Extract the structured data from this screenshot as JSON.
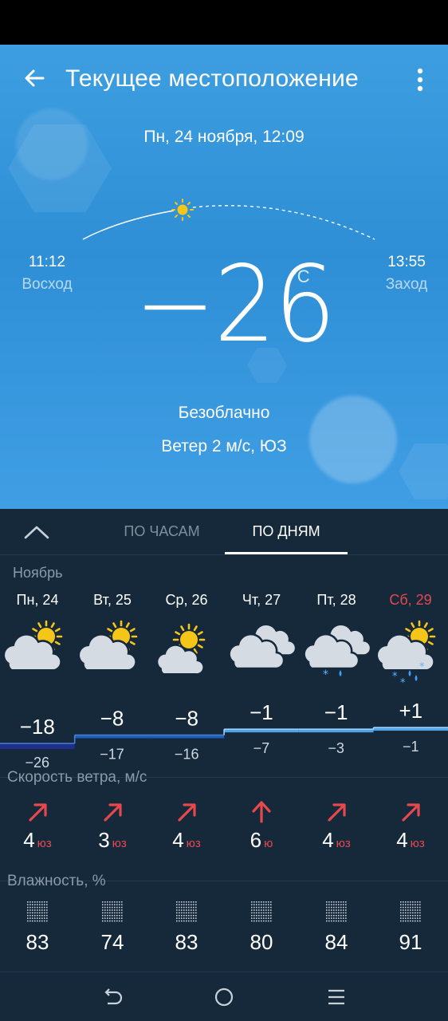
{
  "header": {
    "title": "Текущее местоположение",
    "back_icon": "arrow-left-icon",
    "menu_icon": "more-vertical-icon"
  },
  "current": {
    "datetime": "Пн, 24 ноября, 12:09",
    "sunrise": {
      "time": "11:12",
      "label": "Восход"
    },
    "sunset": {
      "time": "13:55",
      "label": "Заход"
    },
    "temperature": "−26",
    "unit": "°C",
    "condition": "Безоблачно",
    "wind": "Ветер 2 м/с, ЮЗ"
  },
  "tabs": {
    "hours": "ПО ЧАСАМ",
    "days": "ПО ДНЯМ",
    "active": "days"
  },
  "month": "Ноябрь",
  "days": [
    {
      "name": "Пн, 24",
      "weekend": false,
      "icon": "partly-cloudy-icon",
      "high": "−18",
      "low": "−26",
      "high_val": -18,
      "low_val": -26,
      "wind_speed": "4",
      "wind_dir": "юз",
      "wind_arrow": "arrow-up-right-icon",
      "humidity": "83"
    },
    {
      "name": "Вт, 25",
      "weekend": false,
      "icon": "partly-cloudy-icon",
      "high": "−8",
      "low": "−17",
      "high_val": -8,
      "low_val": -17,
      "wind_speed": "3",
      "wind_dir": "юз",
      "wind_arrow": "arrow-up-right-icon",
      "humidity": "74"
    },
    {
      "name": "Ср, 26",
      "weekend": false,
      "icon": "mostly-sunny-icon",
      "high": "−8",
      "low": "−16",
      "high_val": -8,
      "low_val": -16,
      "wind_speed": "4",
      "wind_dir": "юз",
      "wind_arrow": "arrow-up-right-icon",
      "humidity": "83"
    },
    {
      "name": "Чт, 27",
      "weekend": false,
      "icon": "cloudy-icon",
      "high": "−1",
      "low": "−7",
      "high_val": -1,
      "low_val": -7,
      "wind_speed": "6",
      "wind_dir": "ю",
      "wind_arrow": "arrow-up-icon",
      "humidity": "80"
    },
    {
      "name": "Пт, 28",
      "weekend": false,
      "icon": "cloudy-snow-rain-icon",
      "high": "−1",
      "low": "−3",
      "high_val": -1,
      "low_val": -3,
      "wind_speed": "4",
      "wind_dir": "юз",
      "wind_arrow": "arrow-up-right-icon",
      "humidity": "84"
    },
    {
      "name": "Сб, 29",
      "weekend": true,
      "icon": "partly-cloudy-snow-rain-icon",
      "high": "+1",
      "low": "−1",
      "high_val": 1,
      "low_val": -1,
      "wind_speed": "4",
      "wind_dir": "юз",
      "wind_arrow": "arrow-up-right-icon",
      "humidity": "91"
    }
  ],
  "sections": {
    "wind": "Скорость ветра, м/с",
    "humidity": "Влажность, %"
  },
  "colors": {
    "accent_red": "#e5484d",
    "panel_bg": "#15293b",
    "sky_blue": "#3d9ee0",
    "sun_yellow": "#f5c518"
  },
  "navbar": {
    "back_icon": "nav-back-icon",
    "home_icon": "nav-home-icon",
    "recents_icon": "nav-menu-icon"
  }
}
